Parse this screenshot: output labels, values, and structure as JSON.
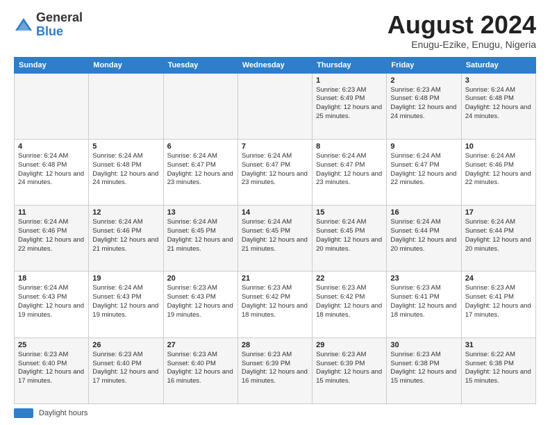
{
  "header": {
    "logo_general": "General",
    "logo_blue": "Blue",
    "month_year": "August 2024",
    "location": "Enugu-Ezike, Enugu, Nigeria"
  },
  "days_of_week": [
    "Sunday",
    "Monday",
    "Tuesday",
    "Wednesday",
    "Thursday",
    "Friday",
    "Saturday"
  ],
  "footer": {
    "label": "Daylight hours"
  },
  "weeks": [
    [
      {
        "day": "",
        "info": ""
      },
      {
        "day": "",
        "info": ""
      },
      {
        "day": "",
        "info": ""
      },
      {
        "day": "",
        "info": ""
      },
      {
        "day": "1",
        "info": "Sunrise: 6:23 AM\nSunset: 6:49 PM\nDaylight: 12 hours\nand 25 minutes."
      },
      {
        "day": "2",
        "info": "Sunrise: 6:23 AM\nSunset: 6:48 PM\nDaylight: 12 hours\nand 24 minutes."
      },
      {
        "day": "3",
        "info": "Sunrise: 6:24 AM\nSunset: 6:48 PM\nDaylight: 12 hours\nand 24 minutes."
      }
    ],
    [
      {
        "day": "4",
        "info": "Sunrise: 6:24 AM\nSunset: 6:48 PM\nDaylight: 12 hours\nand 24 minutes."
      },
      {
        "day": "5",
        "info": "Sunrise: 6:24 AM\nSunset: 6:48 PM\nDaylight: 12 hours\nand 24 minutes."
      },
      {
        "day": "6",
        "info": "Sunrise: 6:24 AM\nSunset: 6:47 PM\nDaylight: 12 hours\nand 23 minutes."
      },
      {
        "day": "7",
        "info": "Sunrise: 6:24 AM\nSunset: 6:47 PM\nDaylight: 12 hours\nand 23 minutes."
      },
      {
        "day": "8",
        "info": "Sunrise: 6:24 AM\nSunset: 6:47 PM\nDaylight: 12 hours\nand 23 minutes."
      },
      {
        "day": "9",
        "info": "Sunrise: 6:24 AM\nSunset: 6:47 PM\nDaylight: 12 hours\nand 22 minutes."
      },
      {
        "day": "10",
        "info": "Sunrise: 6:24 AM\nSunset: 6:46 PM\nDaylight: 12 hours\nand 22 minutes."
      }
    ],
    [
      {
        "day": "11",
        "info": "Sunrise: 6:24 AM\nSunset: 6:46 PM\nDaylight: 12 hours\nand 22 minutes."
      },
      {
        "day": "12",
        "info": "Sunrise: 6:24 AM\nSunset: 6:46 PM\nDaylight: 12 hours\nand 21 minutes."
      },
      {
        "day": "13",
        "info": "Sunrise: 6:24 AM\nSunset: 6:45 PM\nDaylight: 12 hours\nand 21 minutes."
      },
      {
        "day": "14",
        "info": "Sunrise: 6:24 AM\nSunset: 6:45 PM\nDaylight: 12 hours\nand 21 minutes."
      },
      {
        "day": "15",
        "info": "Sunrise: 6:24 AM\nSunset: 6:45 PM\nDaylight: 12 hours\nand 20 minutes."
      },
      {
        "day": "16",
        "info": "Sunrise: 6:24 AM\nSunset: 6:44 PM\nDaylight: 12 hours\nand 20 minutes."
      },
      {
        "day": "17",
        "info": "Sunrise: 6:24 AM\nSunset: 6:44 PM\nDaylight: 12 hours\nand 20 minutes."
      }
    ],
    [
      {
        "day": "18",
        "info": "Sunrise: 6:24 AM\nSunset: 6:43 PM\nDaylight: 12 hours\nand 19 minutes."
      },
      {
        "day": "19",
        "info": "Sunrise: 6:24 AM\nSunset: 6:43 PM\nDaylight: 12 hours\nand 19 minutes."
      },
      {
        "day": "20",
        "info": "Sunrise: 6:23 AM\nSunset: 6:43 PM\nDaylight: 12 hours\nand 19 minutes."
      },
      {
        "day": "21",
        "info": "Sunrise: 6:23 AM\nSunset: 6:42 PM\nDaylight: 12 hours\nand 18 minutes."
      },
      {
        "day": "22",
        "info": "Sunrise: 6:23 AM\nSunset: 6:42 PM\nDaylight: 12 hours\nand 18 minutes."
      },
      {
        "day": "23",
        "info": "Sunrise: 6:23 AM\nSunset: 6:41 PM\nDaylight: 12 hours\nand 18 minutes."
      },
      {
        "day": "24",
        "info": "Sunrise: 6:23 AM\nSunset: 6:41 PM\nDaylight: 12 hours\nand 17 minutes."
      }
    ],
    [
      {
        "day": "25",
        "info": "Sunrise: 6:23 AM\nSunset: 6:40 PM\nDaylight: 12 hours\nand 17 minutes."
      },
      {
        "day": "26",
        "info": "Sunrise: 6:23 AM\nSunset: 6:40 PM\nDaylight: 12 hours\nand 17 minutes."
      },
      {
        "day": "27",
        "info": "Sunrise: 6:23 AM\nSunset: 6:40 PM\nDaylight: 12 hours\nand 16 minutes."
      },
      {
        "day": "28",
        "info": "Sunrise: 6:23 AM\nSunset: 6:39 PM\nDaylight: 12 hours\nand 16 minutes."
      },
      {
        "day": "29",
        "info": "Sunrise: 6:23 AM\nSunset: 6:39 PM\nDaylight: 12 hours\nand 15 minutes."
      },
      {
        "day": "30",
        "info": "Sunrise: 6:23 AM\nSunset: 6:38 PM\nDaylight: 12 hours\nand 15 minutes."
      },
      {
        "day": "31",
        "info": "Sunrise: 6:22 AM\nSunset: 6:38 PM\nDaylight: 12 hours\nand 15 minutes."
      }
    ]
  ]
}
